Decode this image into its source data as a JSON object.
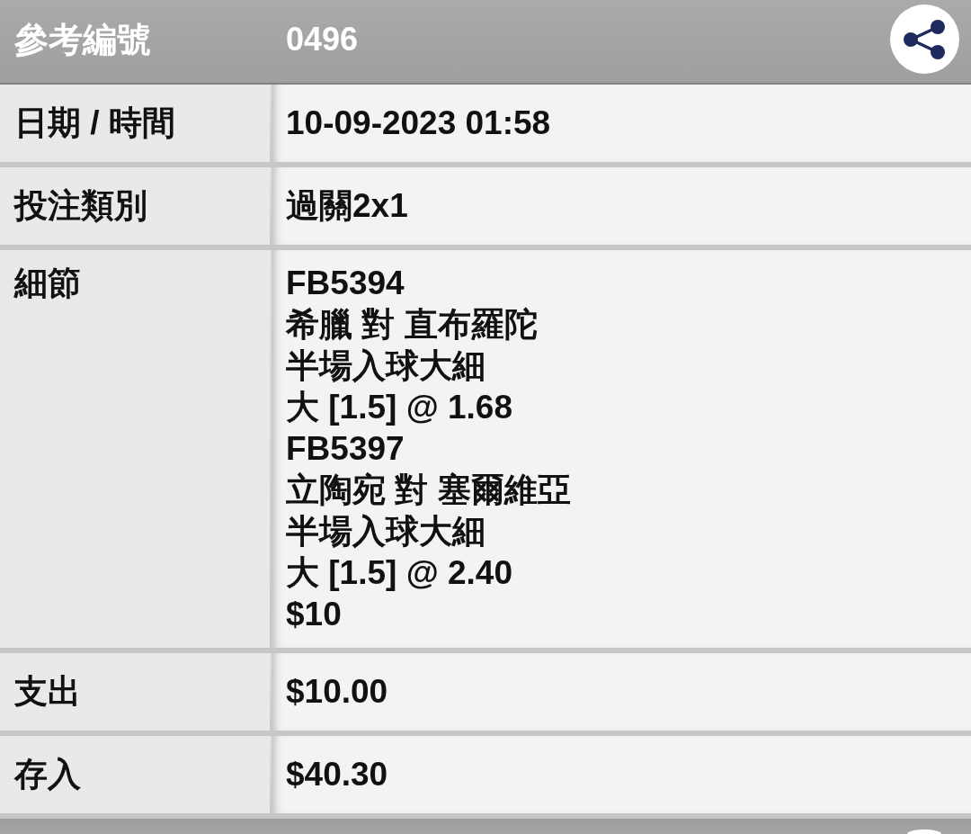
{
  "header": {
    "label": "參考編號",
    "value": "0496"
  },
  "rows": [
    {
      "kind": "text",
      "label": "日期 / 時間",
      "value": "10-09-2023 01:58"
    },
    {
      "kind": "text",
      "label": "投注類別",
      "value": "過關2x1"
    },
    {
      "kind": "details",
      "label": "細節",
      "legs": [
        {
          "code": "FB5394",
          "match": "希臘 對 直布羅陀",
          "market": "半場入球大細",
          "selection": "大 [1.5] @ 1.68"
        },
        {
          "code": "FB5397",
          "match": "立陶宛 對 塞爾維亞",
          "market": "半場入球大細",
          "selection": "大 [1.5] @ 2.40"
        }
      ],
      "stake": "$10"
    },
    {
      "kind": "text",
      "label": "支出",
      "value": "$10.00"
    },
    {
      "kind": "text",
      "label": "存入",
      "value": "$40.30"
    }
  ]
}
